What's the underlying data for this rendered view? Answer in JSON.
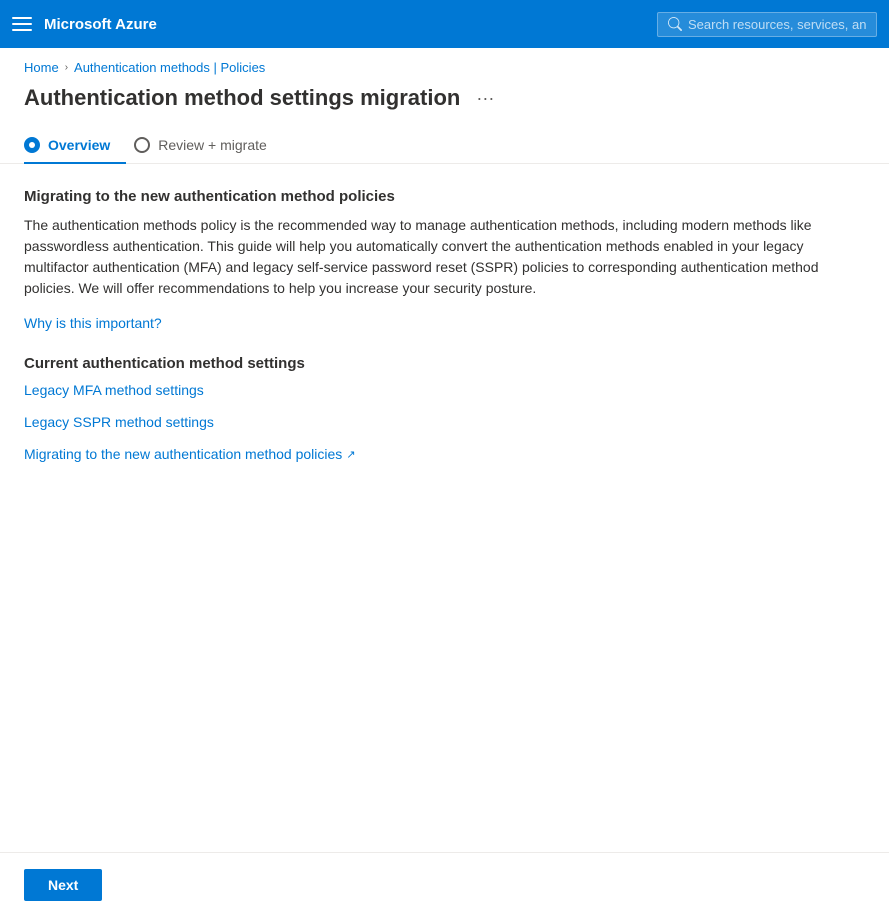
{
  "topbar": {
    "logo": "Microsoft Azure",
    "search_placeholder": "Search resources, services, an"
  },
  "breadcrumb": {
    "home_label": "Home",
    "parent_label": "Authentication methods | Policies"
  },
  "page": {
    "title": "Authentication method settings migration",
    "more_options_label": "···"
  },
  "tabs": [
    {
      "id": "overview",
      "label": "Overview",
      "state": "active"
    },
    {
      "id": "review-migrate",
      "label": "Review + migrate",
      "state": "inactive"
    }
  ],
  "content": {
    "main_section_title": "Migrating to the new authentication method policies",
    "description": "The authentication methods policy is the recommended way to manage authentication methods, including modern methods like passwordless authentication. This guide will help you automatically convert the authentication methods enabled in your legacy multifactor authentication (MFA) and legacy self-service password reset (SSPR) policies to corresponding authentication method policies. We will offer recommendations to help you increase your security posture.",
    "why_link": "Why is this important?",
    "current_section_title": "Current authentication method settings",
    "links": [
      {
        "label": "Legacy MFA method settings",
        "external": false
      },
      {
        "label": "Legacy SSPR method settings",
        "external": false
      },
      {
        "label": "Migrating to the new authentication method policies",
        "external": true
      }
    ]
  },
  "footer": {
    "next_label": "Next"
  }
}
